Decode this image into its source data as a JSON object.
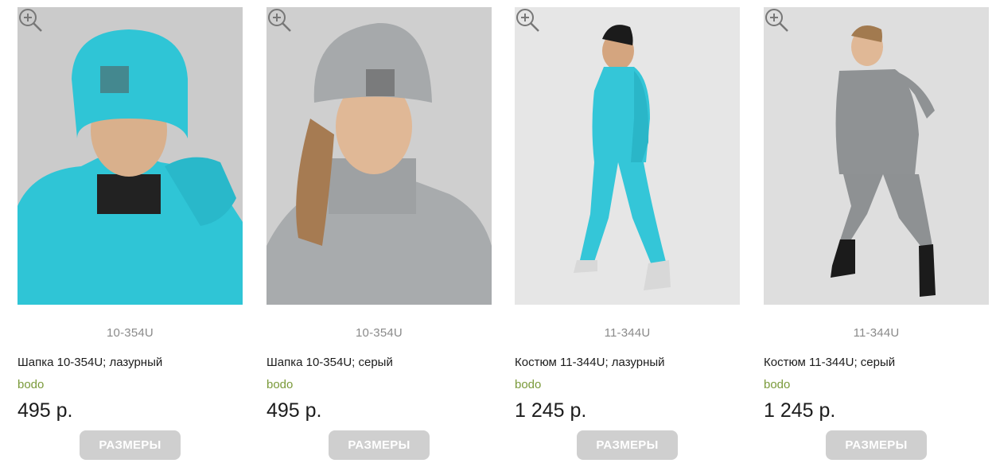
{
  "products": [
    {
      "article": "10-354U",
      "title": "Шапка 10-354U; лазурный",
      "brand": "bodo",
      "price": "495 р.",
      "button": "РАЗМЕРЫ",
      "zoom_icon": "zoom-in-icon",
      "color": "#2fc5d6"
    },
    {
      "article": "10-354U",
      "title": "Шапка 10-354U; серый",
      "brand": "bodo",
      "price": "495 р.",
      "button": "РАЗМЕРЫ",
      "zoom_icon": "zoom-in-icon",
      "color": "#a6a9ab"
    },
    {
      "article": "11-344U",
      "title": "Костюм 11-344U; лазурный",
      "brand": "bodo",
      "price": "1 245 р.",
      "button": "РАЗМЕРЫ",
      "zoom_icon": "zoom-in-icon",
      "color": "#34c6d8"
    },
    {
      "article": "11-344U",
      "title": "Костюм 11-344U; серый",
      "brand": "bodo",
      "price": "1 245 р.",
      "button": "РАЗМЕРЫ",
      "zoom_icon": "zoom-in-icon",
      "color": "#8f9294"
    }
  ],
  "colors": {
    "brand_green": "#7a9a3a",
    "button_gray": "#cfcfcf",
    "article_gray": "#8a8a8a"
  }
}
